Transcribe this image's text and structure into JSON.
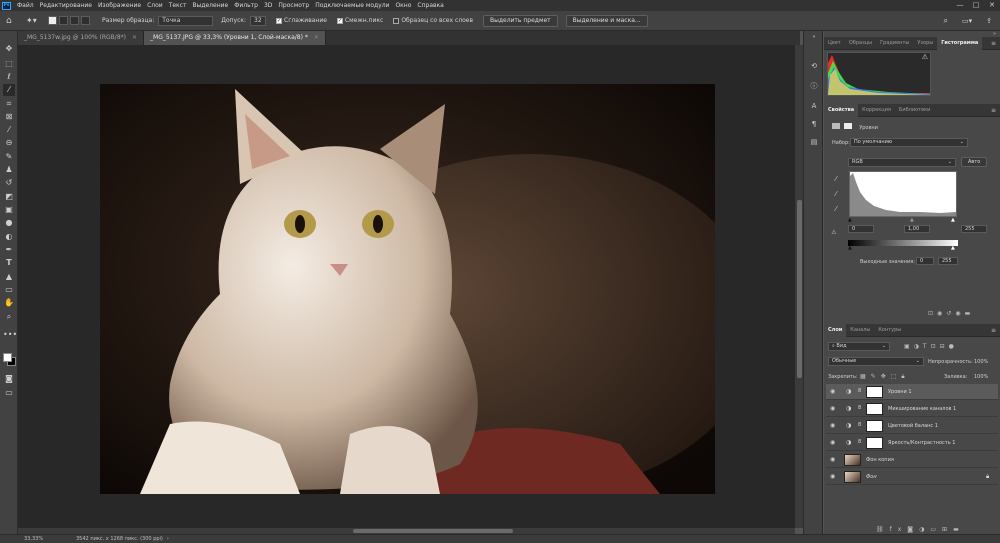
{
  "app": {
    "logo": "Ps"
  },
  "menu": [
    "Файл",
    "Редактирование",
    "Изображение",
    "Слои",
    "Текст",
    "Выделение",
    "Фильтр",
    "3D",
    "Просмотр",
    "Подключаемые модули",
    "Окно",
    "Справка"
  ],
  "window_controls": {
    "minimize": "—",
    "maximize": "□",
    "close": "✕"
  },
  "options": {
    "sample_size_label": "Размер образца:",
    "sample_size_value": "Точка",
    "tolerance_label": "Допуск:",
    "tolerance_value": "32",
    "antialias_label": "Сглаживание",
    "contiguous_label": "Смежн.пикс",
    "all_layers_label": "Образец со всех слоев",
    "select_subject": "Выделить предмет",
    "select_mask": "Выделение и маска..."
  },
  "tabs": [
    {
      "label": "_MG_5137w.jpg @ 100% (RGB/8*)",
      "active": false
    },
    {
      "label": "_MG_5137.JPG @ 33,3% (Уровни 1, Слой-маска/8) *",
      "active": true
    }
  ],
  "status": {
    "zoom": "33,33%",
    "doc": "3542 пикс. x 1268 пикс. (300 ppi)"
  },
  "histogram_panel": {
    "tabs": [
      "Цвет",
      "Образцы",
      "Градиенты",
      "Узоры",
      "Гистограмма"
    ],
    "active": "Гистограмма"
  },
  "properties_panel": {
    "tabs": [
      "Свойства",
      "Коррекция",
      "Библиотеки"
    ],
    "title": "Уровни",
    "preset_label": "Набор:",
    "preset_value": "По умолчанию",
    "channel": "RGB",
    "auto": "Авто",
    "input_black": "0",
    "input_gamma": "1,00",
    "input_white": "255",
    "output_label": "Выходные значения:",
    "output_black": "0",
    "output_white": "255"
  },
  "layers_panel": {
    "tabs": [
      "Слои",
      "Каналы",
      "Контуры"
    ],
    "filter": "Вид",
    "blend": "Обычные",
    "opacity_label": "Непрозрачность:",
    "opacity": "100%",
    "lock_label": "Закрепить:",
    "fill_label": "Заливка:",
    "fill": "100%",
    "layers": [
      {
        "name": "Уровни 1",
        "type": "adjustment",
        "selected": true
      },
      {
        "name": "Микширование каналов 1",
        "type": "adjustment",
        "selected": false
      },
      {
        "name": "Цветовой баланс 1",
        "type": "adjustment",
        "selected": false
      },
      {
        "name": "Яркость/Контрастность 1",
        "type": "adjustment",
        "selected": false
      },
      {
        "name": "Фон копия",
        "type": "image",
        "selected": false
      },
      {
        "name": "Фон",
        "type": "image",
        "selected": false
      }
    ]
  },
  "colors": {
    "accent": "#31a8ff",
    "ui_dark": "#323232",
    "ui_mid": "#424242",
    "canvas": "#282828"
  }
}
